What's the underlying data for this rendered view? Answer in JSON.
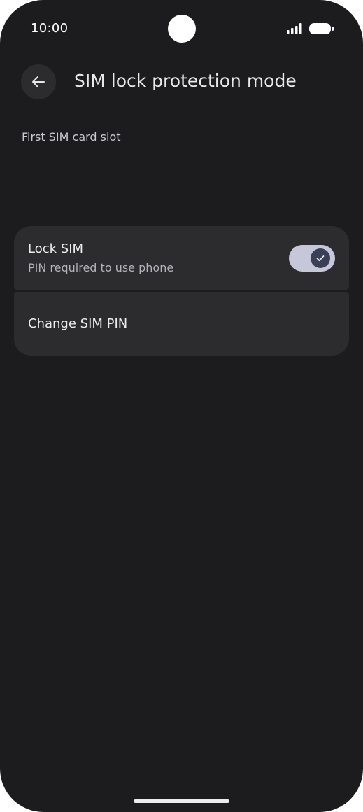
{
  "status_bar": {
    "time": "10:00",
    "signal_icon": "signal-bars-icon",
    "battery_icon": "battery-icon"
  },
  "app_bar": {
    "back_icon": "arrow-back-icon",
    "title": "SIM lock protection mode"
  },
  "section": {
    "label": "First SIM card slot"
  },
  "settings": {
    "lock_sim": {
      "title": "Lock SIM",
      "summary": "PIN required to use phone",
      "toggle_icon": "check-icon"
    },
    "change_pin": {
      "title": "Change SIM PIN"
    }
  },
  "colors": {
    "background": "#1c1c1e",
    "card": "#2c2c2e",
    "toggle_track": "#c6c8da",
    "toggle_thumb": "#3b4056"
  }
}
